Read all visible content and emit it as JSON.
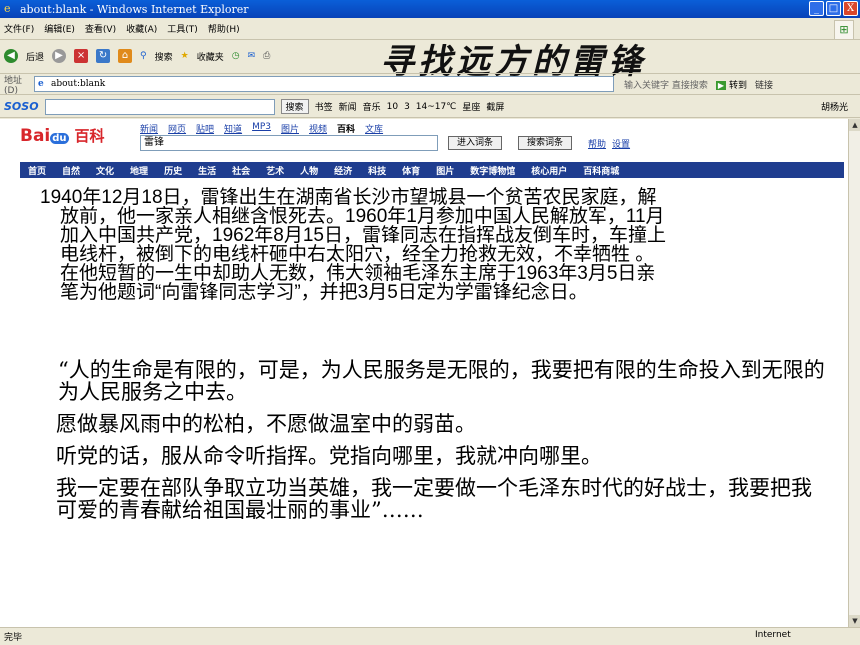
{
  "window": {
    "title": "about:blank - Windows Internet Explorer",
    "buttons": [
      "_",
      "□",
      "X"
    ]
  },
  "menu": [
    "文件(F)",
    "编辑(E)",
    "查看(V)",
    "收藏(A)",
    "工具(T)",
    "帮助(H)"
  ],
  "toolbar": {
    "back": "后退",
    "search": "搜索",
    "favorites": "收藏夹"
  },
  "slide_title": "寻找远方的雷锋",
  "address": {
    "label": "地址(D)",
    "value": "about:blank",
    "hint": "输入关键字 直接搜索",
    "go": "转到",
    "links": "链接"
  },
  "soso": {
    "logo": "SOSO",
    "search_btn": "搜索",
    "items": [
      "书签",
      "新闻",
      "音乐",
      "10",
      "3",
      "14~17℃",
      "星座",
      "截屏"
    ],
    "user": "胡杨光"
  },
  "baidu": {
    "logo_text": "Bai",
    "logo_paw": "du",
    "logo_baike": "百科",
    "nav": [
      "新闻",
      "网页",
      "贴吧",
      "知道",
      "MP3",
      "图片",
      "视频",
      "百科",
      "文库"
    ],
    "nav_current": 7,
    "query": "雷锋",
    "btn_enter": "进入词条",
    "btn_search": "搜索词条",
    "help": "帮助",
    "settings": "设置",
    "categories": [
      "首页",
      "自然",
      "文化",
      "地理",
      "历史",
      "生活",
      "社会",
      "艺术",
      "人物",
      "经济",
      "科技",
      "体育",
      "图片",
      "数字博物馆",
      "核心用户",
      "百科商城"
    ]
  },
  "body": {
    "bio": [
      "1940年12月18日，雷锋出生在湖南省长沙市望城县一个贫苦农民家庭，解",
      "放前，他一家亲人相继含恨死去。1960年1月参加中国人民解放军，11月",
      "加入中国共产党，1962年8月15日，雷锋同志在指挥战友倒车时，车撞上",
      "电线杆，被倒下的电线杆砸中右太阳穴，经全力抢救无效，不幸牺牲 。",
      "在他短暂的一生中却助人无数，伟大领袖毛泽东主席于1963年3月5日亲",
      "笔为他题词“向雷锋同志学习”，并把3月5日定为学雷锋纪念日。"
    ],
    "quotes": [
      "“人的生命是有限的，可是，为人民服务是无限的，我要把有限的生命投入到无限的为人民服务之中去。",
      "愿做暴风雨中的松柏，不愿做温室中的弱苗。",
      "听党的话，服从命令听指挥。党指向哪里，我就冲向哪里。",
      "我一定要在部队争取立功当英雄，我一定要做一个毛泽东时代的好战士，我要把我可爱的青春献给祖国最壮丽的事业”……"
    ]
  },
  "status": {
    "left": "完毕",
    "zone": "Internet"
  }
}
